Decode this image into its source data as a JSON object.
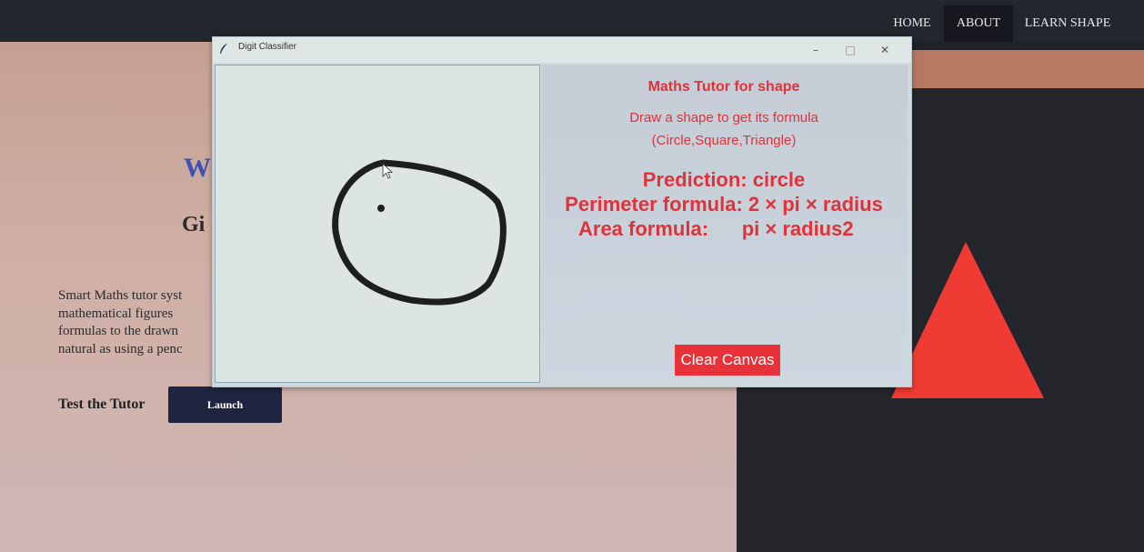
{
  "nav": {
    "home": "HOME",
    "about": "ABOUT",
    "learn": "LEARN SHAPE"
  },
  "hero": {
    "title_fragment": "W",
    "subtitle_fragment": "Gi",
    "desc_lines": [
      "Smart Maths tutor syst",
      "mathematical figures",
      "formulas to the drawn",
      "natural as using a penc"
    ],
    "test_label": "Test the Tutor",
    "launch_label": "Launch"
  },
  "window": {
    "title": "Digit Classifier",
    "controls": {
      "min": "–",
      "max": "□",
      "close": "✕"
    }
  },
  "info": {
    "heading": "Maths Tutor for shape",
    "instruction": "Draw a shape to get its formula",
    "shapes": "(Circle,Square,Triangle)",
    "prediction": "Prediction: circle",
    "perimeter": "Perimeter formula: 2 × pi × radius",
    "area": "Area formula:      pi × radius2",
    "clear_label": "Clear Canvas"
  },
  "colors": {
    "accent_red": "#e0323a",
    "button_red": "#e8323a",
    "triangle_red": "#ef3b33",
    "nav_bg": "#22262d",
    "launch_bg": "#1f2540"
  },
  "icons": {
    "title": "feather-icon",
    "cursor": "arrow-cursor-icon"
  }
}
